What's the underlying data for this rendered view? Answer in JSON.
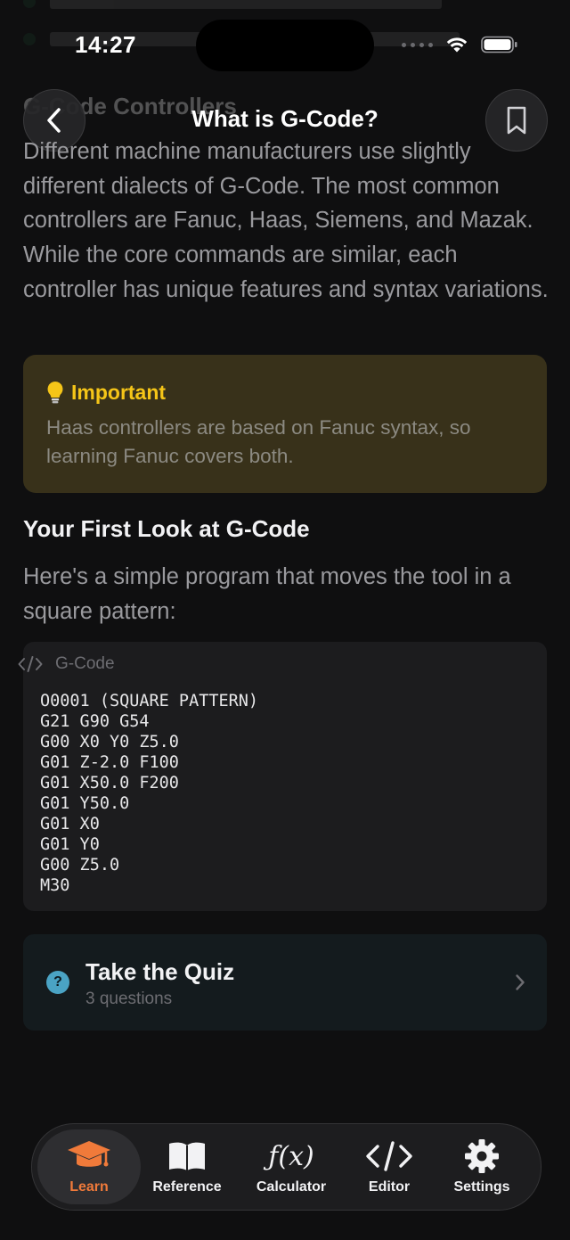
{
  "status": {
    "time": "14:27"
  },
  "nav": {
    "title": "What is G-Code?"
  },
  "background_section_title": "G-Code Controllers",
  "intro_paragraph": "Different machine manufacturers use slightly different dialects of G-Code. The most common controllers are Fanuc, Haas, Siemens, and Mazak. While the core commands are similar, each controller has unique features and syntax variations.",
  "callout": {
    "title": "Important",
    "body": "Haas controllers are based on Fanuc syntax, so learning Fanuc covers both.",
    "icon": "lightbulb-icon",
    "accent_color": "#f5c518"
  },
  "first_look": {
    "heading": "Your First Look at G-Code",
    "description": "Here's a simple program that moves the tool in a square pattern:"
  },
  "code_block": {
    "language": "G-Code",
    "lines": [
      "O0001 (SQUARE PATTERN)",
      "G21 G90 G54",
      "G00 X0 Y0 Z5.0",
      "G01 Z-2.0 F100",
      "G01 X50.0 F200",
      "G01 Y50.0",
      "G01 X0",
      "G01 Y0",
      "G00 Z5.0",
      "M30"
    ]
  },
  "quiz": {
    "title": "Take the Quiz",
    "subtitle": "3 questions"
  },
  "tabs": [
    {
      "label": "Learn",
      "icon": "graduation-cap-icon",
      "active": true
    },
    {
      "label": "Reference",
      "icon": "book-icon",
      "active": false
    },
    {
      "label": "Calculator",
      "icon": "function-icon",
      "glyph": "ƒ(x)",
      "active": false
    },
    {
      "label": "Editor",
      "icon": "code-icon",
      "active": false
    },
    {
      "label": "Settings",
      "icon": "gear-icon",
      "active": false
    }
  ],
  "colors": {
    "accent": "#f07a3a",
    "background": "#0f0f10",
    "quiz_icon": "#4aa3c4"
  }
}
